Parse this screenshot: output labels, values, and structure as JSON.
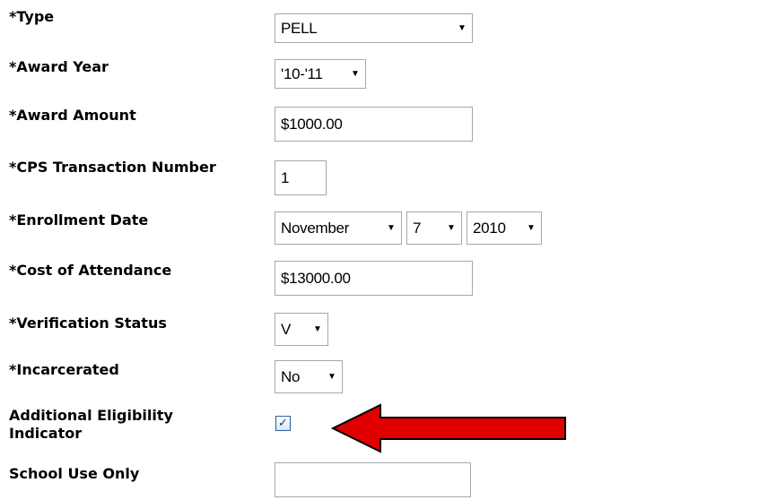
{
  "fields": {
    "type": {
      "label": "*Type",
      "value": "PELL"
    },
    "award_year": {
      "label": "*Award Year",
      "value": "'10-'11"
    },
    "award_amount": {
      "label": "*Award Amount",
      "value": "$1000.00"
    },
    "cps_transaction_number": {
      "label": "*CPS Transaction Number",
      "value": "1"
    },
    "enrollment_date": {
      "label": "*Enrollment Date",
      "month": "November",
      "day": "7",
      "year": "2010"
    },
    "cost_of_attendance": {
      "label": "*Cost of Attendance",
      "value": "$13000.00"
    },
    "verification_status": {
      "label": "*Verification Status",
      "value": "V"
    },
    "incarcerated": {
      "label": "*Incarcerated",
      "value": "No"
    },
    "additional_eligibility_indicator": {
      "label_line1": "Additional Eligibility",
      "label_line2": "Indicator",
      "checked": true,
      "check_glyph": "✓"
    },
    "school_use_only": {
      "label": "School Use Only",
      "value": ""
    }
  },
  "icons": {
    "dropdown_arrow": "▼",
    "annotation": "red-arrow-icon"
  },
  "colors": {
    "annotation_arrow_fill": "#e00000",
    "annotation_arrow_stroke": "#000000",
    "control_border": "#a7a7a7",
    "checkbox_border": "#2d5e9c"
  }
}
